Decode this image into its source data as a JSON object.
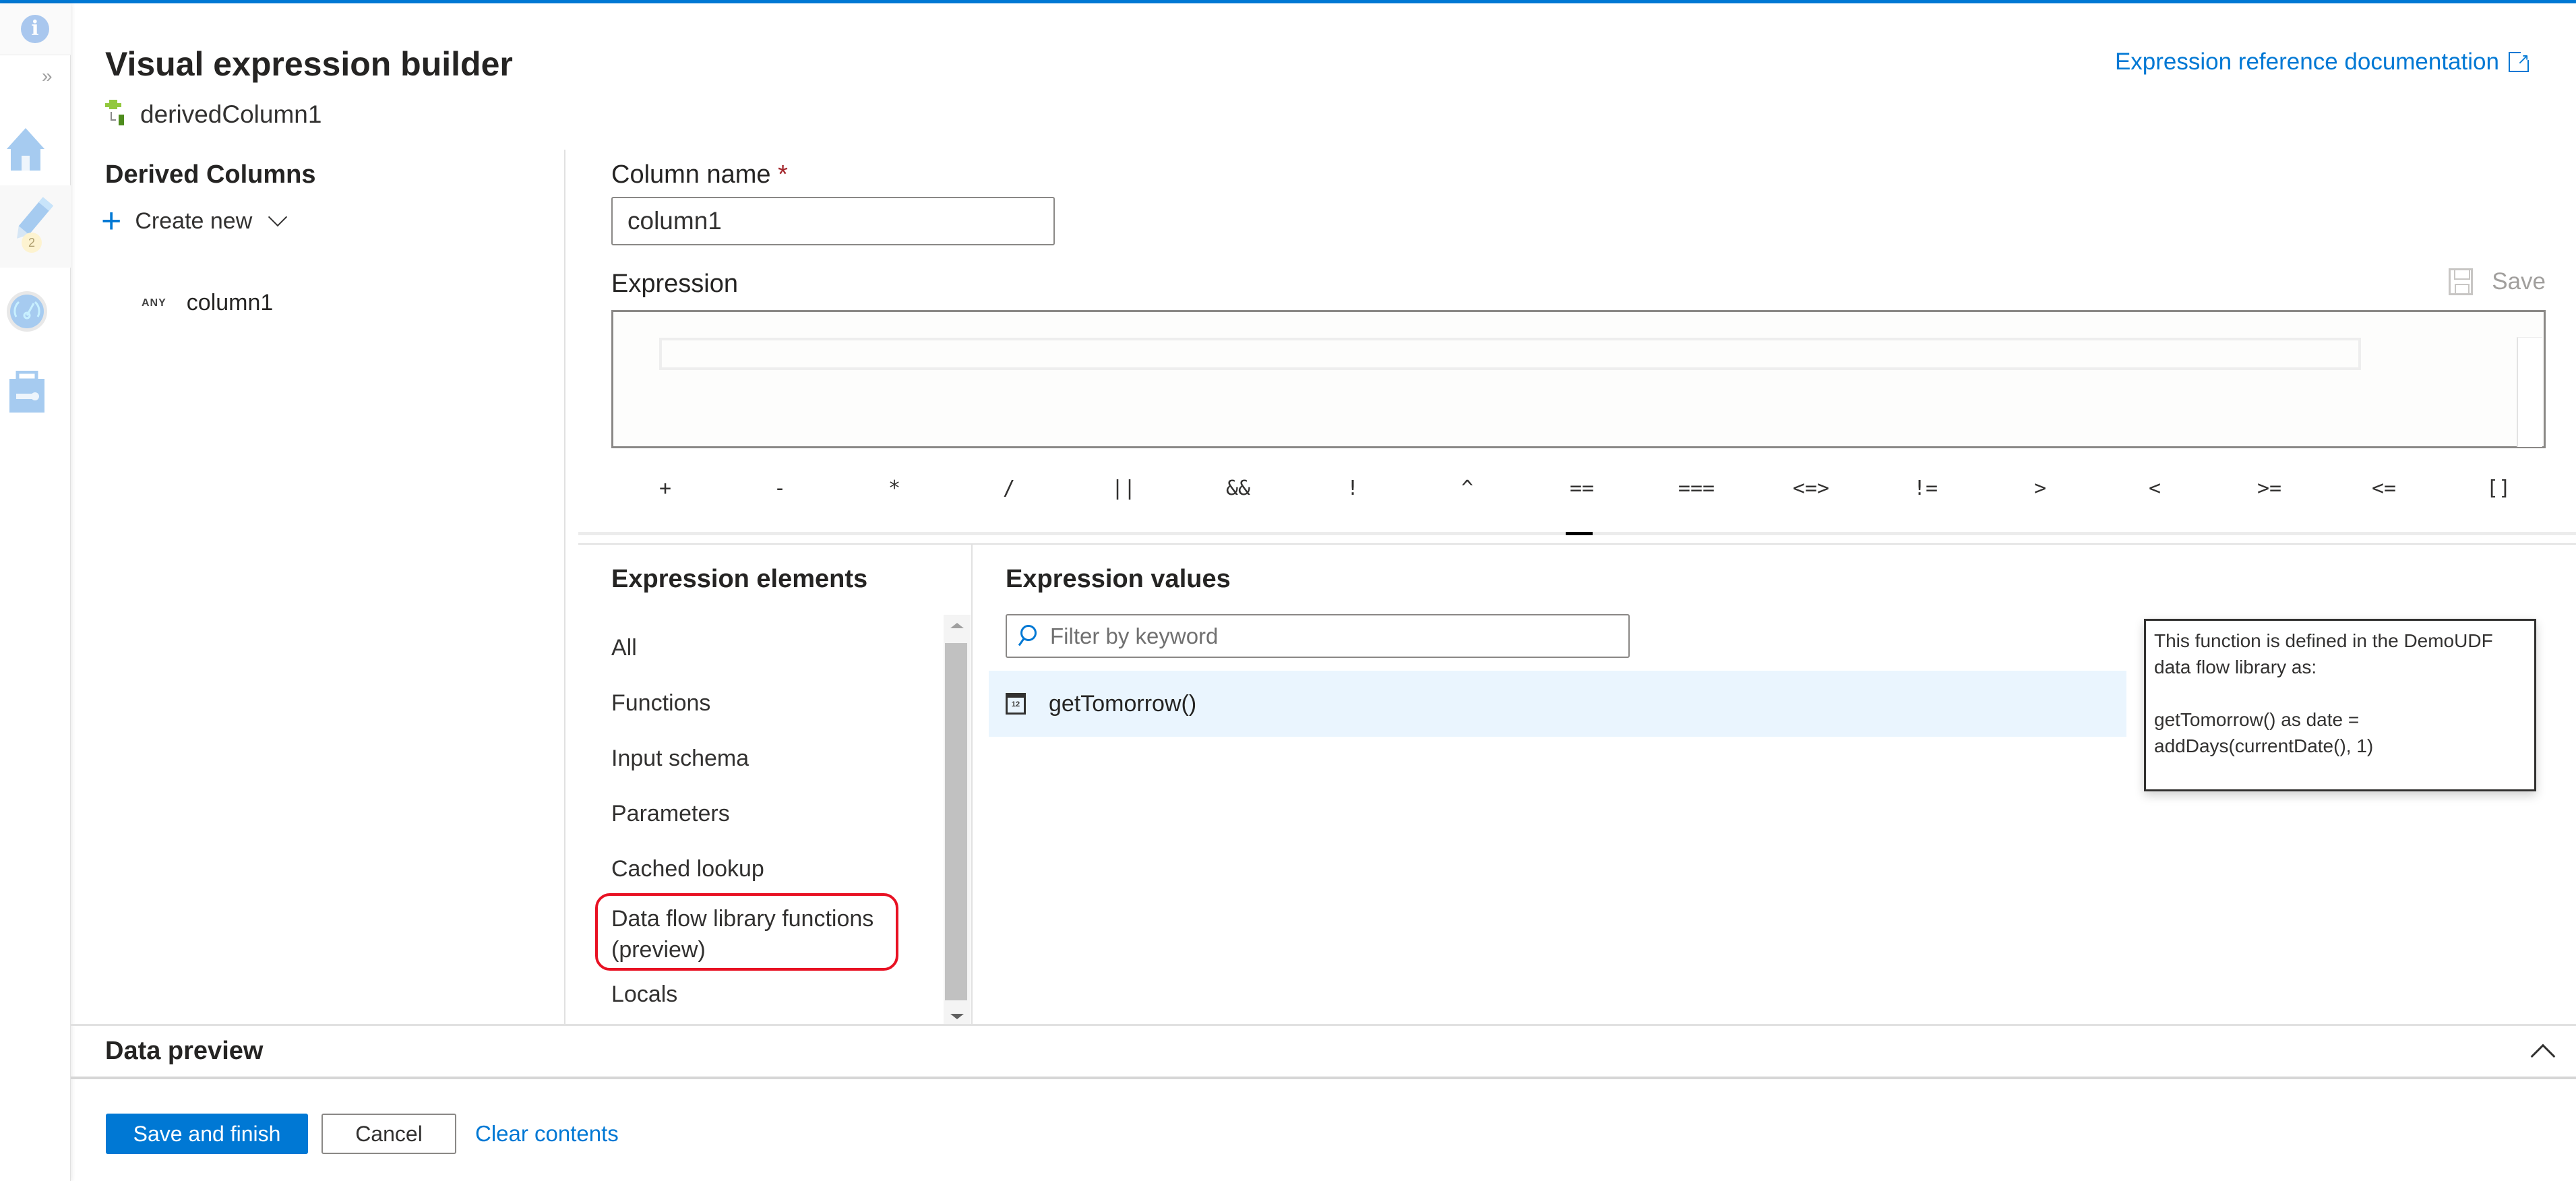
{
  "header": {
    "title": "Visual expression builder",
    "transformation_name": "derivedColumn1",
    "doc_link_label": "Expression reference documentation"
  },
  "rail": {
    "badge_count": "2",
    "icons": [
      "info-icon",
      "expand-icon",
      "home-icon",
      "author-pencil-icon",
      "monitor-icon",
      "manage-toolbox-icon"
    ]
  },
  "derived_columns": {
    "heading": "Derived Columns",
    "create_new_label": "Create new",
    "items": [
      {
        "type": "ANY",
        "name": "column1"
      }
    ]
  },
  "column_name": {
    "label": "Column name",
    "required_marker": "*",
    "value": "column1"
  },
  "expression": {
    "label": "Expression",
    "save_label": "Save",
    "value": ""
  },
  "operators": [
    "+",
    "-",
    "*",
    "/",
    "||",
    "&&",
    "!",
    "^",
    "==",
    "===",
    "<=>",
    "!=",
    ">",
    "<",
    ">=",
    "<=",
    "[]"
  ],
  "expression_elements": {
    "heading": "Expression elements",
    "items": [
      "All",
      "Functions",
      "Input schema",
      "Parameters",
      "Cached lookup",
      "Data flow library functions (preview)",
      "Locals"
    ],
    "highlighted_item": "Data flow library functions (preview)"
  },
  "expression_values": {
    "heading": "Expression values",
    "filter_placeholder": "Filter by keyword",
    "items": [
      {
        "icon": "calendar-icon",
        "icon_text": "12",
        "name": "getTomorrow()"
      }
    ]
  },
  "tooltip": {
    "text": "This function is defined in the DemoUDF data flow library as:\n\ngetTomorrow() as date = addDays(currentDate(), 1)"
  },
  "data_preview": {
    "title": "Data preview"
  },
  "footer": {
    "save_finish_label": "Save and finish",
    "cancel_label": "Cancel",
    "clear_label": "Clear contents"
  },
  "colors": {
    "accent": "#0078d4",
    "highlight_border": "#e81123",
    "selected_row_bg": "#eaf5fe",
    "required_marker": "#a4262c"
  }
}
